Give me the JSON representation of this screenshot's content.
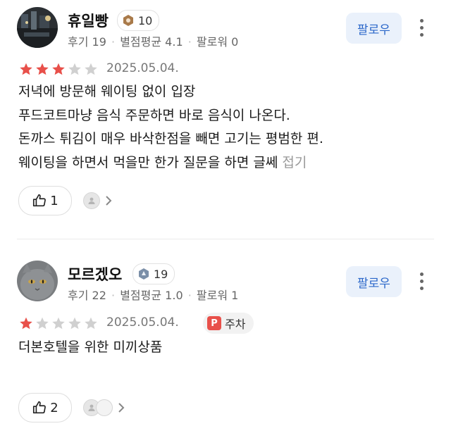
{
  "reviews": [
    {
      "username": "휴일빵",
      "badge": "10",
      "meta": {
        "reviews_label": "후기",
        "reviews": "19",
        "avg_label": "별점평균",
        "avg": "4.1",
        "followers_label": "팔로워",
        "followers": "0"
      },
      "follow_label": "팔로우",
      "rating": 3,
      "rating_max": 5,
      "date": "2025.05.04.",
      "lines": [
        "저녁에 방문해 웨이팅 없이 입장",
        "푸드코트마냥 음식 주문하면 바로 음식이 나온다.",
        "돈까스 튀김이 매우 바삭한점을 빼면 고기는 평범한 편.",
        "웨이팅을 하면서 먹을만 한가 질문을 하면 글쎄"
      ],
      "fold_label": "접기",
      "likes": "1"
    },
    {
      "username": "모르겠오",
      "badge": "19",
      "meta": {
        "reviews_label": "후기",
        "reviews": "22",
        "avg_label": "별점평균",
        "avg": "1.0",
        "followers_label": "팔로워",
        "followers": "1"
      },
      "follow_label": "팔로우",
      "rating": 1,
      "rating_max": 5,
      "date": "2025.05.04.",
      "tag": {
        "icon": "P",
        "label": "주차"
      },
      "lines": [
        "더본호텔을 위한 미끼상품"
      ],
      "likes": "2"
    }
  ],
  "colors": {
    "star_filled": "#e8504a",
    "star_empty": "#d0d0d0",
    "follow_bg": "#eaf1fb",
    "follow_text": "#2b67c9"
  }
}
